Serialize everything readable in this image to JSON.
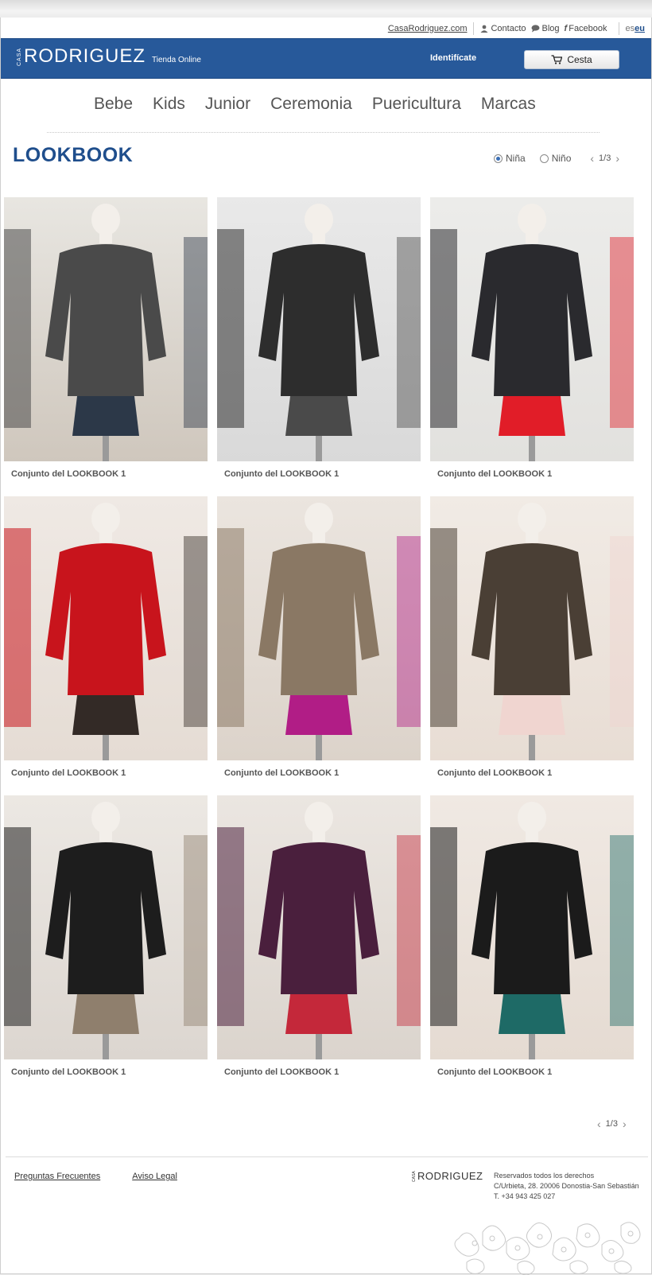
{
  "topbar": {
    "site_link": "CasaRodriguez.com",
    "contact": "Contacto",
    "blog": "Blog",
    "facebook": "Facebook",
    "lang_es": "es",
    "lang_eu": "eu"
  },
  "header": {
    "logo_casa": "CASA",
    "logo_name": "RODRIGUEZ",
    "tagline": "Tienda Online",
    "login": "Identifícate",
    "cart": "Cesta",
    "colors": {
      "header_bg": "#27599a",
      "accent": "#1f4e8c"
    }
  },
  "categories": [
    "Bebe",
    "Kids",
    "Junior",
    "Ceremonia",
    "Puericultura",
    "Marcas"
  ],
  "lookbook": {
    "title": "LOOKBOOK",
    "filters": [
      {
        "label": "Niña",
        "selected": true
      },
      {
        "label": "Niño",
        "selected": false
      }
    ],
    "page": "1/3"
  },
  "items": [
    {
      "caption": "Conjunto del LOOKBOOK 1",
      "palette": [
        "#cfc7bd",
        "#e8e6e1",
        "#4a4a4a",
        "#2c3848"
      ]
    },
    {
      "caption": "Conjunto del LOOKBOOK 1",
      "palette": [
        "#d9d9d9",
        "#e9e9e9",
        "#2d2d2d",
        "#4a4a4a"
      ]
    },
    {
      "caption": "Conjunto del LOOKBOOK 1",
      "palette": [
        "#e2e1de",
        "#ececea",
        "#2a2a2e",
        "#e11d28"
      ]
    },
    {
      "caption": "Conjunto del LOOKBOOK 1",
      "palette": [
        "#e5dcd4",
        "#efe9e4",
        "#c8141c",
        "#332a26"
      ]
    },
    {
      "caption": "Conjunto del LOOKBOOK 1",
      "palette": [
        "#dcd3ca",
        "#ebe5df",
        "#8a7864",
        "#b11d86"
      ]
    },
    {
      "caption": "Conjunto del LOOKBOOK 1",
      "palette": [
        "#e8ddd4",
        "#f1ebe5",
        "#4a3f35",
        "#f0d5d0"
      ]
    },
    {
      "caption": "Conjunto del LOOKBOOK 1",
      "palette": [
        "#dcd6d0",
        "#ece8e3",
        "#1d1d1d",
        "#8f7f6d"
      ]
    },
    {
      "caption": "Conjunto del LOOKBOOK 1",
      "palette": [
        "#dbd4cd",
        "#ebe6e1",
        "#4a1f3d",
        "#c4283a"
      ]
    },
    {
      "caption": "Conjunto del LOOKBOOK 1",
      "palette": [
        "#e5dbd2",
        "#f0e9e3",
        "#1b1b1b",
        "#1e6a66"
      ]
    }
  ],
  "bottom_pager": {
    "page": "1/3"
  },
  "footer": {
    "links": [
      "Preguntas Frecuentes",
      "Aviso Legal"
    ],
    "logo_casa": "CASA",
    "logo_name": "RODRIGUEZ",
    "rights": "Reservados todos los derechos",
    "address": "C/Urbieta, 28. 20006 Donostia-San Sebastián",
    "phone": "T. +34 943 425 027"
  }
}
